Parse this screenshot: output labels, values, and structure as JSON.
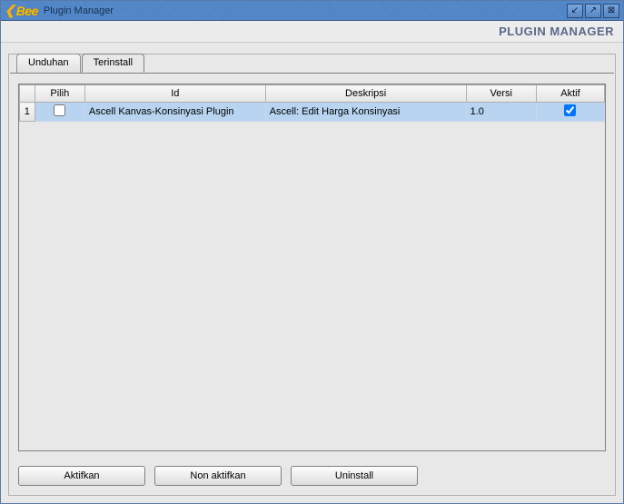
{
  "window": {
    "logo_text": "Bee",
    "title": "Plugin Manager",
    "header": "PLUGIN MANAGER"
  },
  "tabs": {
    "download": "Unduhan",
    "installed": "Terinstall"
  },
  "table": {
    "headers": {
      "rownum": "",
      "pilih": "Pilih",
      "id": "Id",
      "deskripsi": "Deskripsi",
      "versi": "Versi",
      "aktif": "Aktif"
    },
    "rows": [
      {
        "num": "1",
        "pilih": false,
        "id": "Ascell Kanvas-Konsinyasi Plugin",
        "deskripsi": "Ascell: Edit Harga Konsinyasi",
        "versi": "1.0",
        "aktif": true
      }
    ]
  },
  "buttons": {
    "aktifkan": "Aktifkan",
    "non_aktifkan": "Non aktifkan",
    "uninstall": "Uninstall"
  }
}
